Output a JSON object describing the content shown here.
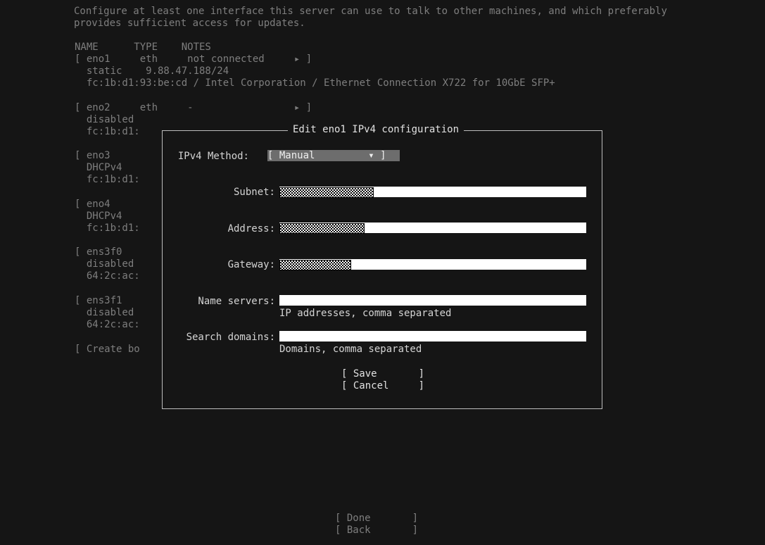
{
  "intro": {
    "line1": "Configure at least one interface this server can use to talk to other machines, and which preferably",
    "line2": "provides sufficient access for updates."
  },
  "table": {
    "header": "NAME      TYPE    NOTES",
    "rows": [
      "[ eno1     eth     not connected     ▸ ]",
      "  static    9.88.47.188/24",
      "  fc:1b:d1:93:be:cd / Intel Corporation / Ethernet Connection X722 for 10GbE SFP+",
      "[ eno2     eth     -                 ▸ ]",
      "  disabled",
      "  fc:1b:d1:",
      "[ eno3",
      "  DHCPv4",
      "  fc:1b:d1:",
      "[ eno4",
      "  DHCPv4",
      "  fc:1b:d1:",
      "[ ens3f0",
      "  disabled",
      "  64:2c:ac:",
      "[ ens3f1",
      "  disabled",
      "  64:2c:ac:",
      "[ Create bo"
    ]
  },
  "dialog": {
    "title": "Edit eno1 IPv4 configuration",
    "method_label": "IPv4 Method:",
    "method_value": "[ Manual         ▾ ]",
    "subnet_label": "Subnet:",
    "address_label": "Address:",
    "gateway_label": "Gateway:",
    "nameservers_label": "Name servers:",
    "nameservers_hint": "IP addresses, comma separated",
    "searchdomains_label": "Search domains:",
    "searchdomains_hint": "Domains, comma separated",
    "save_label": "[ Save       ]",
    "cancel_label": "[ Cancel     ]"
  },
  "footer": {
    "done_label": "[ Done       ]",
    "back_label": "[ Back       ]"
  }
}
